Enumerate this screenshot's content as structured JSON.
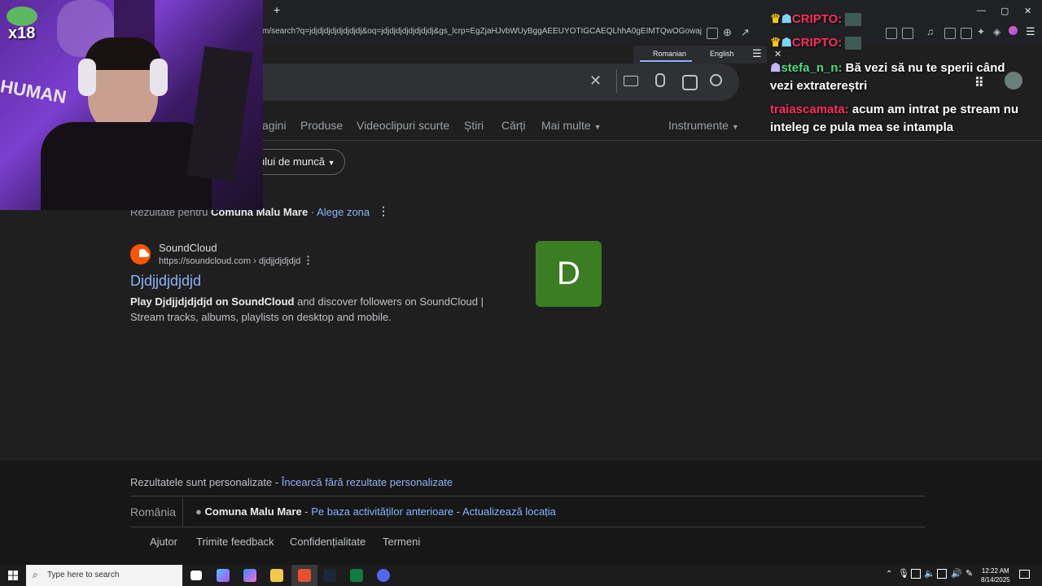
{
  "browser": {
    "new_tab": "+",
    "url": "m/search?q=jdjdjdjdjdjdjdjdj&oq=jdjdjdjdjdjdjdjdj&gs_lcrp=EgZjaHJvbWUyBggAEEUYOTIGCAEQLhhA0gEIMTQwOGowajGo...",
    "window_controls": [
      "—",
      "▢",
      "✕"
    ],
    "translate": {
      "from": "Romanian",
      "to": "English"
    }
  },
  "tabs": {
    "images": "agini",
    "products": "Produse",
    "short_videos": "Videoclipuri scurte",
    "news": "Știri",
    "books": "Cărți",
    "more": "Mai multe",
    "tools": "Instrumente",
    "filter_chip": "ului de muncă"
  },
  "location": {
    "prefix": "Rezultate pentru",
    "place": "Comuna Malu Mare",
    "sep": "·",
    "change": "Alege zona"
  },
  "result": {
    "site": "SoundCloud",
    "url": "https://soundcloud.com › djdjjdjdjdjd",
    "title": "Djdjjdjdjdjd",
    "snippet_bold": "Play Djdjjdjdjdjd on SoundCloud",
    "snippet_rest": " and discover followers on SoundCloud | Stream tracks, albums, playlists on desktop and mobile.",
    "thumb_letter": "D"
  },
  "footer": {
    "personalized": "Rezultatele sunt personalizate",
    "dash": "-",
    "try_without": "Încearcă fără rezultate personalizate",
    "country": "România",
    "place": "Comuna Malu Mare",
    "based_on": "Pe baza activităților anterioare",
    "update": "Actualizează locația",
    "links": [
      "Ajutor",
      "Trimite feedback",
      "Confidențialitate",
      "Termeni"
    ]
  },
  "overlay": {
    "badge": "x18",
    "shirt_text": "HUMAN"
  },
  "chat": [
    {
      "user": "CRIPTO:",
      "user_color": "#ff2e5f",
      "text": ""
    },
    {
      "user": "CRIPTO:",
      "user_color": "#ff2e5f",
      "text": ""
    },
    {
      "user": "stefa_n_n:",
      "user_color": "#4ade80",
      "text": "Bă vezi să nu te sperii când vezi extratereștri"
    },
    {
      "user": "traiascamata:",
      "user_color": "#ff2e5f",
      "text": "acum am intrat pe stream nu inteleg ce pula mea se intampla"
    }
  ],
  "taskbar": {
    "search_placeholder": "Type here to search",
    "time": "12:22 AM",
    "date": "8/14/2025"
  },
  "colors": {
    "link": "#8ab4f8",
    "bg": "#1f1f1f",
    "thumb": "#3b7d22",
    "soundcloud": "#ff5500"
  }
}
